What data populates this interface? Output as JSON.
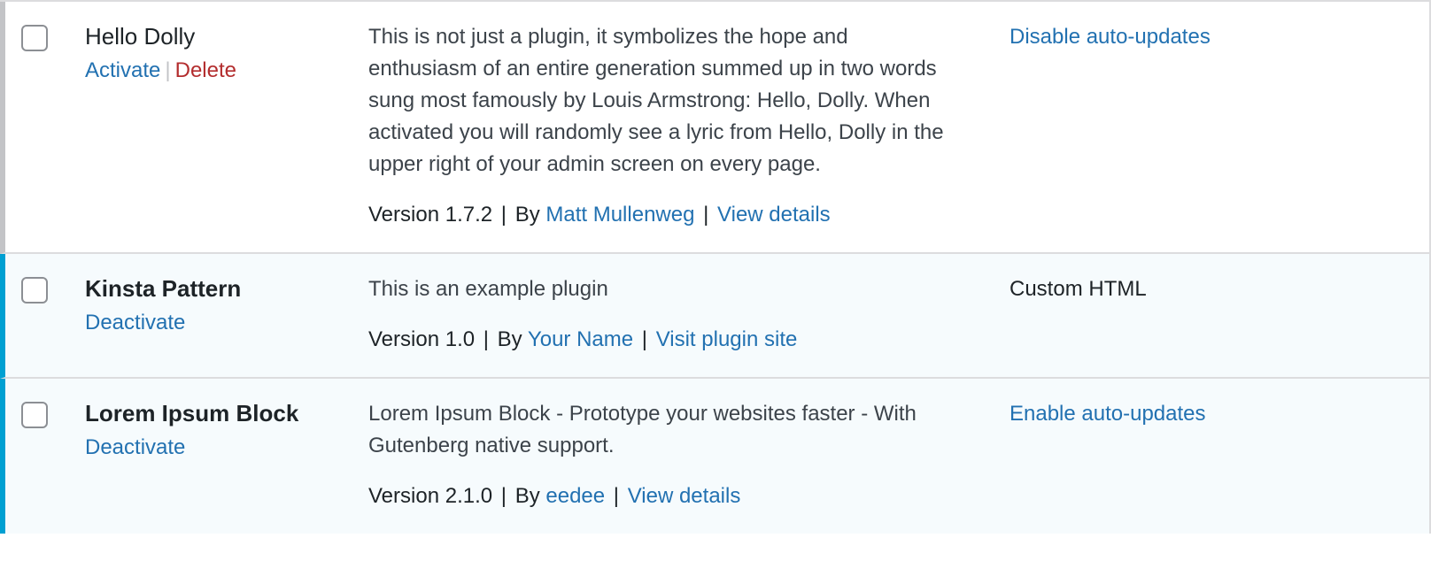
{
  "colors": {
    "link": "#2271b1",
    "delete": "#b32d2e",
    "active_marker": "#00a0d2",
    "inactive_marker": "#c3c4c7",
    "active_row_bg": "#f6fbfd",
    "row_border": "#dcdcde"
  },
  "plugins": [
    {
      "name": "Hello Dolly",
      "state": "inactive",
      "actions": [
        {
          "label": "Activate",
          "kind": "activate"
        },
        {
          "label": "Delete",
          "kind": "delete"
        }
      ],
      "action_separator": "|",
      "description": "This is not just a plugin, it symbolizes the hope and enthusiasm of an entire generation summed up in two words sung most famously by Louis Armstrong: Hello, Dolly. When activated you will randomly see a lyric from Hello, Dolly in the upper right of your admin screen on every page.",
      "version_label": "Version 1.7.2",
      "by_label": "By",
      "author": "Matt Mullenweg",
      "details_label": "View details",
      "version_separator": "|",
      "auto_update": {
        "label": "Disable auto-updates",
        "is_link": true
      }
    },
    {
      "name": "Kinsta Pattern",
      "state": "active",
      "actions": [
        {
          "label": "Deactivate",
          "kind": "deactivate"
        }
      ],
      "action_separator": "|",
      "description": "This is an example plugin",
      "version_label": "Version 1.0",
      "by_label": "By",
      "author": "Your Name",
      "details_label": "Visit plugin site",
      "version_separator": "|",
      "auto_update": {
        "label": "Custom HTML",
        "is_link": false
      }
    },
    {
      "name": "Lorem Ipsum Block",
      "state": "active",
      "actions": [
        {
          "label": "Deactivate",
          "kind": "deactivate"
        }
      ],
      "action_separator": "|",
      "description": "Lorem Ipsum Block - Prototype your websites faster - With Gutenberg native support.",
      "version_label": "Version 2.1.0",
      "by_label": "By",
      "author": "eedee",
      "details_label": "View details",
      "version_separator": "|",
      "auto_update": {
        "label": "Enable auto-updates",
        "is_link": true
      }
    }
  ]
}
